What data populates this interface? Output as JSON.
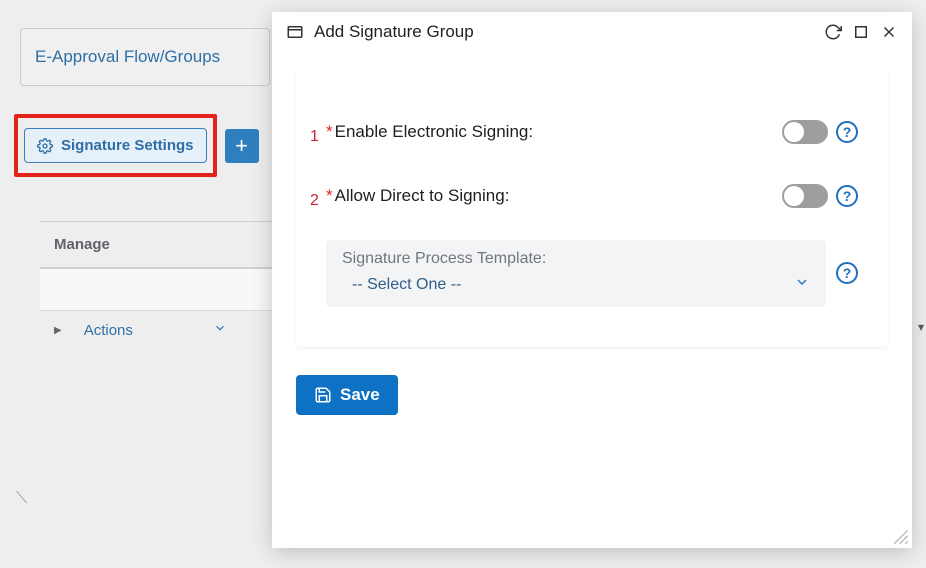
{
  "background": {
    "card_link": "E-Approval Flow/Groups",
    "signature_settings_label": "Signature Settings",
    "table_header": "Manage",
    "actions_label": "Actions"
  },
  "modal": {
    "title": "Add Signature Group",
    "annotations": {
      "one": "1",
      "two": "2"
    },
    "fields": {
      "enable_signing_label": "Enable Electronic Signing:",
      "allow_direct_label": "Allow Direct to Signing:",
      "template_label": "Signature Process Template:",
      "template_value": "-- Select One --"
    },
    "save_label": "Save",
    "help_char": "?"
  }
}
